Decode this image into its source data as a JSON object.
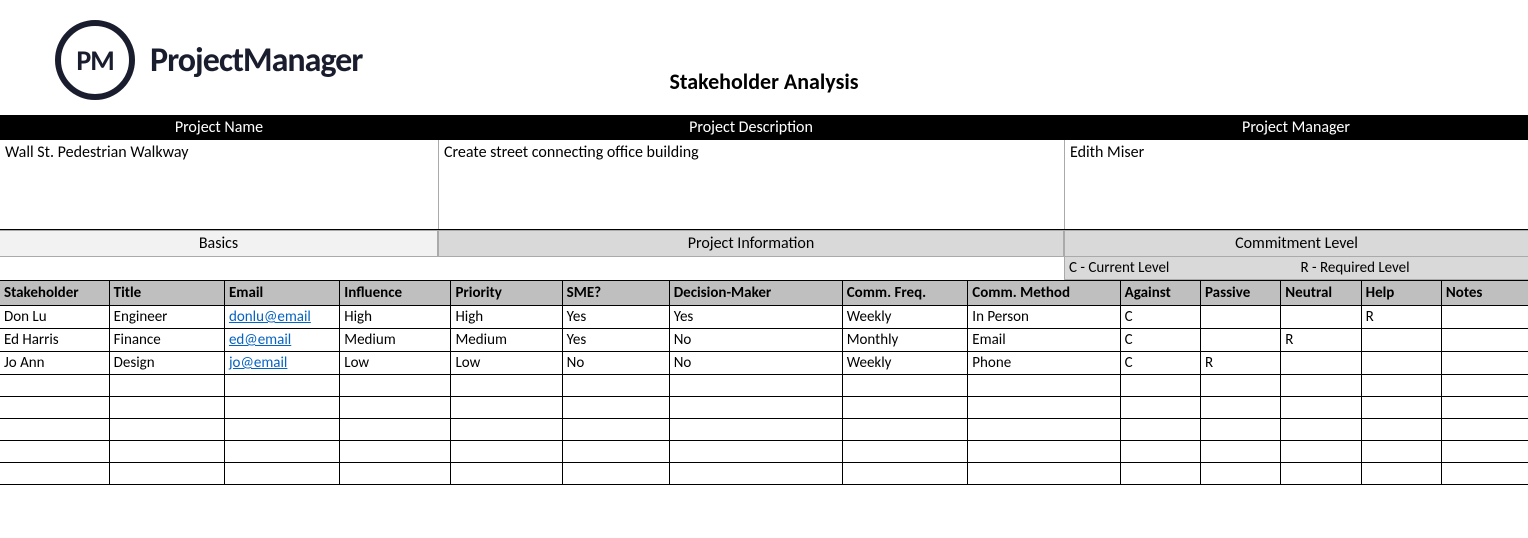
{
  "brand": {
    "badge": "PM",
    "name": "ProjectManager"
  },
  "page_title": "Stakeholder Analysis",
  "info": {
    "headers": {
      "project_name": "Project Name",
      "project_description": "Project Description",
      "project_manager": "Project Manager"
    },
    "values": {
      "project_name": "Wall St. Pedestrian Walkway",
      "project_description": "Create street connecting office building",
      "project_manager": "Edith Miser"
    }
  },
  "sections": {
    "basics": "Basics",
    "project_info": "Project Information",
    "commitment": "Commitment Level"
  },
  "legend": {
    "current": "C - Current Level",
    "required": "R - Required Level"
  },
  "columns": {
    "stakeholder": "Stakeholder",
    "title": "Title",
    "email": "Email",
    "influence": "Influence",
    "priority": "Priority",
    "sme": "SME?",
    "decision_maker": "Decision-Maker",
    "comm_freq": "Comm. Freq.",
    "comm_method": "Comm. Method",
    "against": "Against",
    "passive": "Passive",
    "neutral": "Neutral",
    "help": "Help",
    "notes": "Notes"
  },
  "rows": [
    {
      "stakeholder": "Don Lu",
      "title": "Engineer",
      "email": "donlu@email",
      "influence": "High",
      "priority": "High",
      "sme": "Yes",
      "decision_maker": "Yes",
      "comm_freq": "Weekly",
      "comm_method": "In Person",
      "against": "C",
      "passive": "",
      "neutral": "",
      "help": "R",
      "notes": ""
    },
    {
      "stakeholder": "Ed Harris",
      "title": "Finance",
      "email": "ed@email",
      "influence": "Medium",
      "priority": "Medium",
      "sme": "Yes",
      "decision_maker": "No",
      "comm_freq": "Monthly",
      "comm_method": "Email",
      "against": "C",
      "passive": "",
      "neutral": "R",
      "help": "",
      "notes": ""
    },
    {
      "stakeholder": "Jo Ann",
      "title": "Design",
      "email": "jo@email",
      "influence": "Low",
      "priority": "Low",
      "sme": "No",
      "decision_maker": "No",
      "comm_freq": "Weekly",
      "comm_method": "Phone",
      "against": "C",
      "passive": "R",
      "neutral": "",
      "help": "",
      "notes": ""
    },
    {
      "stakeholder": "",
      "title": "",
      "email": "",
      "influence": "",
      "priority": "",
      "sme": "",
      "decision_maker": "",
      "comm_freq": "",
      "comm_method": "",
      "against": "",
      "passive": "",
      "neutral": "",
      "help": "",
      "notes": ""
    },
    {
      "stakeholder": "",
      "title": "",
      "email": "",
      "influence": "",
      "priority": "",
      "sme": "",
      "decision_maker": "",
      "comm_freq": "",
      "comm_method": "",
      "against": "",
      "passive": "",
      "neutral": "",
      "help": "",
      "notes": ""
    },
    {
      "stakeholder": "",
      "title": "",
      "email": "",
      "influence": "",
      "priority": "",
      "sme": "",
      "decision_maker": "",
      "comm_freq": "",
      "comm_method": "",
      "against": "",
      "passive": "",
      "neutral": "",
      "help": "",
      "notes": ""
    },
    {
      "stakeholder": "",
      "title": "",
      "email": "",
      "influence": "",
      "priority": "",
      "sme": "",
      "decision_maker": "",
      "comm_freq": "",
      "comm_method": "",
      "against": "",
      "passive": "",
      "neutral": "",
      "help": "",
      "notes": ""
    },
    {
      "stakeholder": "",
      "title": "",
      "email": "",
      "influence": "",
      "priority": "",
      "sme": "",
      "decision_maker": "",
      "comm_freq": "",
      "comm_method": "",
      "against": "",
      "passive": "",
      "neutral": "",
      "help": "",
      "notes": ""
    }
  ]
}
